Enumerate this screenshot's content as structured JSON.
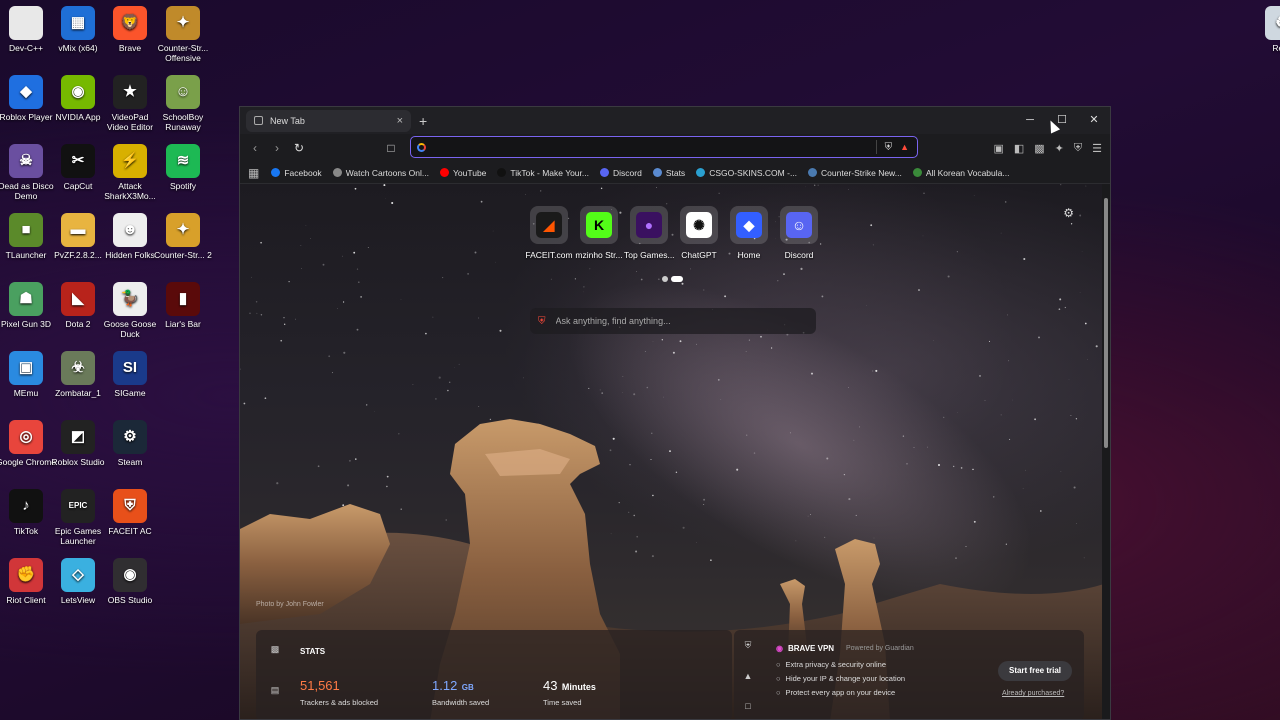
{
  "desktop": {
    "icons": [
      {
        "label": "Dev-C++",
        "icon": "document-icon",
        "color": "#e8e8e8",
        "glyph": ""
      },
      {
        "label": "vMix (x64)",
        "icon": "windows-grid-icon",
        "color": "#1f6fd6",
        "glyph": "▦"
      },
      {
        "label": "Brave",
        "icon": "brave-lion-icon",
        "color": "#fb542b",
        "glyph": "🦁"
      },
      {
        "label": "Counter-Str... Offensive",
        "icon": "csgo-icon",
        "color": "#c08a2a",
        "glyph": "✦"
      },
      {
        "label": "Roblox Player",
        "icon": "roblox-icon",
        "color": "#1f6fe0",
        "glyph": "◆"
      },
      {
        "label": "NVIDIA App",
        "icon": "nvidia-icon",
        "color": "#76b900",
        "glyph": "◉"
      },
      {
        "label": "VideoPad Video Editor",
        "icon": "videopad-icon",
        "color": "#222",
        "glyph": "★"
      },
      {
        "label": "SchoolBoy Runaway",
        "icon": "schoolboy-icon",
        "color": "#7aa04a",
        "glyph": "☺"
      },
      {
        "label": "Dead as Disco Demo",
        "icon": "skull-icon",
        "color": "#6a4fa0",
        "glyph": "☠"
      },
      {
        "label": "CapCut",
        "icon": "capcut-icon",
        "color": "#111",
        "glyph": "✂"
      },
      {
        "label": "Attack SharkX3Mo...",
        "icon": "shark-icon",
        "color": "#d8b000",
        "glyph": "⚡"
      },
      {
        "label": "Spotify",
        "icon": "spotify-icon",
        "color": "#1db954",
        "glyph": "≋"
      },
      {
        "label": "TLauncher",
        "icon": "minecraft-block-icon",
        "color": "#5b8a2a",
        "glyph": "■"
      },
      {
        "label": "PvZF.2.8.2...",
        "icon": "folder-icon",
        "color": "#e8b440",
        "glyph": "▬"
      },
      {
        "label": "Hidden Folks",
        "icon": "hidden-folks-icon",
        "color": "#eee",
        "glyph": "☻"
      },
      {
        "label": "Counter-Str... 2",
        "icon": "cs2-icon",
        "color": "#d8a02a",
        "glyph": "✦"
      },
      {
        "label": "Pixel Gun 3D",
        "icon": "pixel-gun-icon",
        "color": "#4aa060",
        "glyph": "☗"
      },
      {
        "label": "Dota 2",
        "icon": "dota-icon",
        "color": "#b8231b",
        "glyph": "◣"
      },
      {
        "label": "Goose Goose Duck",
        "icon": "goose-icon",
        "color": "#eee",
        "glyph": "🦆"
      },
      {
        "label": "Liar's Bar",
        "icon": "liars-bar-icon",
        "color": "#5a0a0a",
        "glyph": "▮"
      },
      {
        "label": "MEmu",
        "icon": "memu-icon",
        "color": "#2a8ae0",
        "glyph": "▣"
      },
      {
        "label": "Zombatar_1",
        "icon": "zombatar-icon",
        "color": "#6a7a5a",
        "glyph": "☣"
      },
      {
        "label": "SIGame",
        "icon": "sigame-icon",
        "color": "#1a3a8a",
        "glyph": "SI"
      },
      {
        "label": "Google Chrome",
        "icon": "chrome-icon",
        "color": "#e8453c",
        "glyph": "◎"
      },
      {
        "label": "Roblox Studio",
        "icon": "roblox-studio-icon",
        "color": "#222",
        "glyph": "◩"
      },
      {
        "label": "Steam",
        "icon": "steam-icon",
        "color": "#1b2838",
        "glyph": "⚙"
      },
      {
        "label": "TikTok",
        "icon": "tiktok-icon",
        "color": "#111",
        "glyph": "♪"
      },
      {
        "label": "Epic Games Launcher",
        "icon": "epic-games-icon",
        "color": "#222",
        "glyph": "EPIC"
      },
      {
        "label": "FACEIT AC",
        "icon": "faceit-ac-icon",
        "color": "#e8501a",
        "glyph": "⛨"
      },
      {
        "label": "Riot Client",
        "icon": "riot-icon",
        "color": "#d13639",
        "glyph": "✊"
      },
      {
        "label": "LetsView",
        "icon": "letsview-icon",
        "color": "#3ab0e0",
        "glyph": "◇"
      },
      {
        "label": "OBS Studio",
        "icon": "obs-icon",
        "color": "#302e31",
        "glyph": "◉"
      },
      {
        "label": "Recy",
        "icon": "recycle-bin-icon",
        "color": "#cfd8e0",
        "glyph": "♻"
      }
    ]
  },
  "browser": {
    "tab_title": "New Tab",
    "tab_close": "×",
    "new_tab": "+",
    "window_controls": {
      "minimize": "─",
      "maximize": "☐",
      "close": "✕"
    },
    "nav": {
      "back": "‹",
      "forward": "›",
      "reload": "↻",
      "bookmark": "🔖"
    },
    "address": {
      "value": "",
      "placeholder": ""
    },
    "bookmarks": [
      {
        "label": "Facebook",
        "icon": "facebook-icon",
        "color": "#1877f2"
      },
      {
        "label": "Watch Cartoons Onl...",
        "icon": "globe-icon",
        "color": "#888"
      },
      {
        "label": "YouTube",
        "icon": "youtube-icon",
        "color": "#ff0000"
      },
      {
        "label": "TikTok - Make Your...",
        "icon": "tiktok-icon",
        "color": "#111"
      },
      {
        "label": "Discord",
        "icon": "discord-icon",
        "color": "#5865f2"
      },
      {
        "label": "Stats",
        "icon": "stats-icon",
        "color": "#5a8ad0"
      },
      {
        "label": "CSGO-SKINS.COM -...",
        "icon": "csgo-skins-icon",
        "color": "#2aa0d0"
      },
      {
        "label": "Counter-Strike New...",
        "icon": "cs-news-icon",
        "color": "#4a7ab0"
      },
      {
        "label": "All Korean Vocabula...",
        "icon": "korean-vocab-icon",
        "color": "#3a8a3a"
      }
    ]
  },
  "newtab": {
    "tiles": [
      {
        "label": "FACEIT.com",
        "icon": "faceit-icon",
        "bg": "#1a1a1a",
        "fg": "#ff5500",
        "glyph": "◢"
      },
      {
        "label": "mzinho Str...",
        "icon": "kick-icon",
        "bg": "#53fc18",
        "fg": "#000",
        "glyph": "K"
      },
      {
        "label": "Top Games...",
        "icon": "top-games-icon",
        "bg": "#3a1060",
        "fg": "#b070ff",
        "glyph": "●"
      },
      {
        "label": "ChatGPT",
        "icon": "chatgpt-icon",
        "bg": "#ffffff",
        "fg": "#111",
        "glyph": "✺"
      },
      {
        "label": "Home",
        "icon": "roblox-home-icon",
        "bg": "#335fff",
        "fg": "#fff",
        "glyph": "◆"
      },
      {
        "label": "Discord",
        "icon": "discord-icon",
        "bg": "#5865f2",
        "fg": "#fff",
        "glyph": "☺"
      }
    ],
    "ask_placeholder": "Ask anything, find anything...",
    "photo_credit": "Photo by John Fowler",
    "stats": {
      "title": "STATS",
      "trackers_value": "51,561",
      "trackers_label": "Trackers & ads blocked",
      "bandwidth_value": "1.12",
      "bandwidth_unit": "GB",
      "bandwidth_label": "Bandwidth saved",
      "time_value": "43",
      "time_unit": "Minutes",
      "time_label": "Time saved"
    },
    "vpn": {
      "title": "BRAVE VPN",
      "powered": "Powered by Guardian",
      "features": [
        "Extra privacy & security online",
        "Hide your IP & change your location",
        "Protect every app on your device"
      ],
      "trial_button": "Start free trial",
      "purchased_link": "Already purchased?"
    }
  },
  "colors": {
    "accent": "#7a64f0",
    "brave": "#fb542b",
    "trackers": "#ff7a45",
    "bandwidth": "#7fa8ff"
  }
}
